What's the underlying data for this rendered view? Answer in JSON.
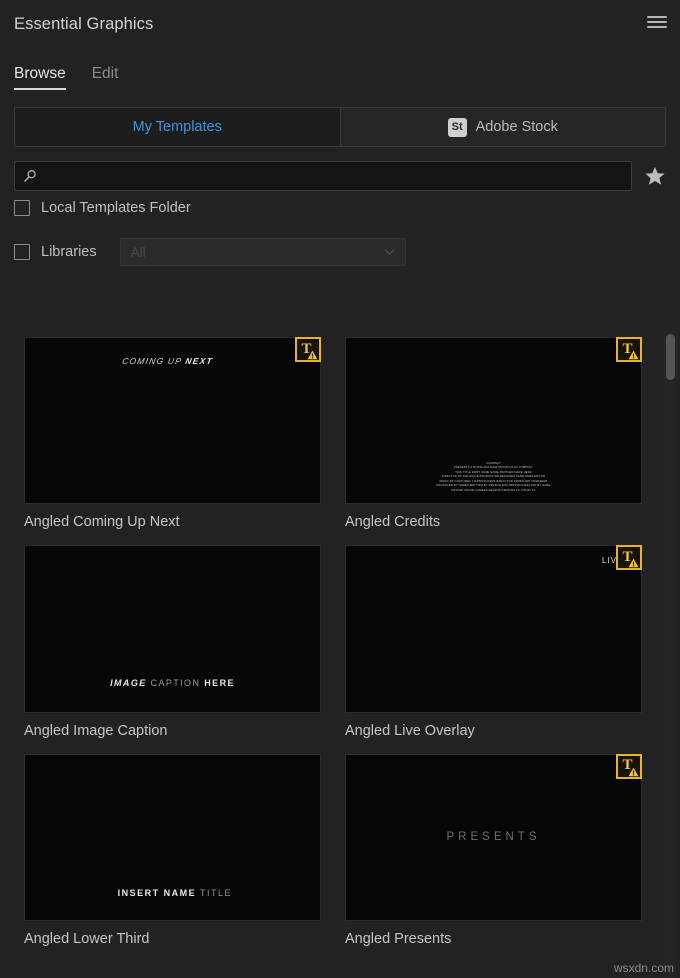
{
  "header": {
    "title": "Essential Graphics",
    "menu_icon": "hamburger-menu-icon"
  },
  "tabs": [
    {
      "label": "Browse",
      "active": true
    },
    {
      "label": "Edit",
      "active": false
    }
  ],
  "source_toggle": {
    "my_templates_label": "My Templates",
    "adobe_stock_label": "Adobe Stock",
    "adobe_stock_badge": "St",
    "active": "My Templates",
    "active_color": "#3d92e0"
  },
  "search": {
    "value": "",
    "placeholder": "",
    "icon": "search-icon",
    "favorites_icon": "star-icon"
  },
  "filters": {
    "local_templates_label": "Local Templates Folder",
    "local_templates_checked": false,
    "libraries_label": "Libraries",
    "libraries_checked": false,
    "libraries_select_value": "All",
    "libraries_select_enabled": false
  },
  "templates": [
    {
      "name": "Angled Coming Up Next",
      "preview_kind": "coming-up-next",
      "preview_text_1": "COMING UP ",
      "preview_text_2": "NEXT",
      "has_warning_badge": true
    },
    {
      "name": "Angled Credits",
      "preview_kind": "credits",
      "credit_lines": [
        "COMPANY           ",
        "PRESENTS A MOVIE       ANOTHER PRODUCTION COMPANY",
        "THIS TITLE          FIRST NAME NAME        ANOTHER NAME HERE",
        "DIRECTOR OF THE MOVIE   PRODUCTION DESIGNER  NAME HERE   EDITOR",
        "MUSIC BY        COSTUMES        CO-PRODUCERS        EXECUTIVE PRODUCER       OVERSEER",
        "PRODUCED BY NAMES        WRITTEN BY PERSON AND PERSON          DIRECTED BY NAME",
        "MASTER   SOUND   CAMERA   MAKEUP   GRADING   FX        VISUAL FX"
      ],
      "has_warning_badge": true
    },
    {
      "name": "Angled Image Caption",
      "preview_kind": "image-caption",
      "preview_text_1": "IMAGE",
      "preview_text_2": "CAPTION",
      "preview_text_3": "HERE",
      "has_warning_badge": false
    },
    {
      "name": "Angled Live Overlay",
      "preview_kind": "live-overlay",
      "preview_text_1": "LIVE",
      "has_warning_badge": true
    },
    {
      "name": "Angled Lower Third",
      "preview_kind": "lower-third",
      "preview_text_1": "INSERT NAME",
      "preview_text_2": "TITLE",
      "has_warning_badge": false
    },
    {
      "name": "Angled Presents",
      "preview_kind": "presents",
      "preview_text_1": "PRESENTS",
      "has_warning_badge": true
    }
  ],
  "scrollbar": {
    "orientation": "vertical",
    "thumb_position_percent": 2
  },
  "watermark": "wsxdn.com"
}
